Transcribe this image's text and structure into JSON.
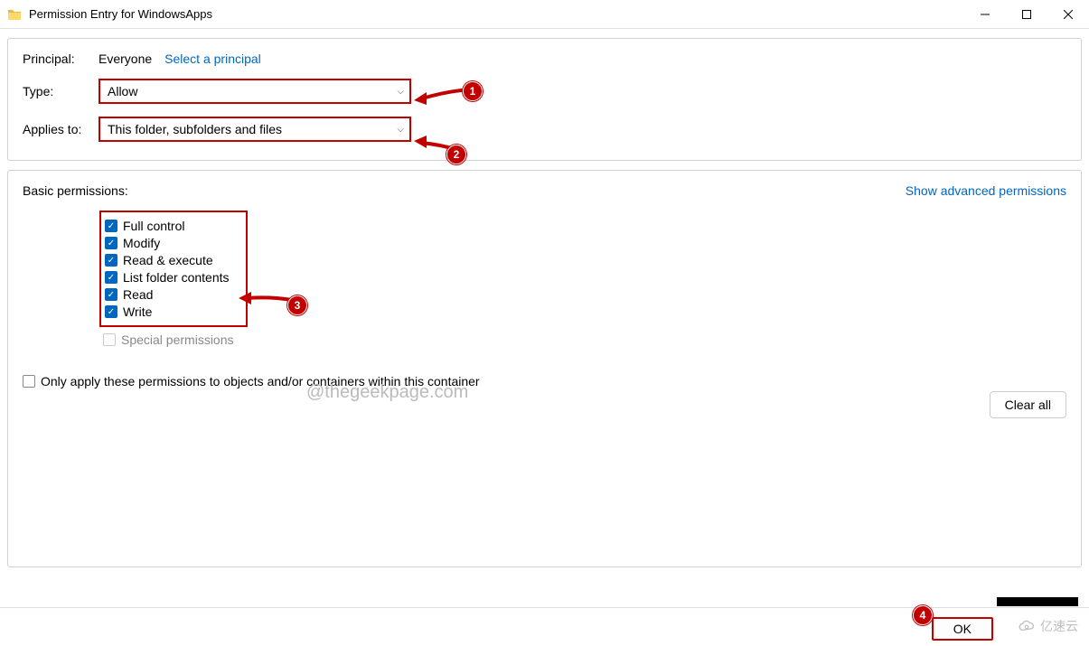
{
  "titlebar": {
    "title": "Permission Entry for WindowsApps"
  },
  "top": {
    "principal_label": "Principal:",
    "principal_value": "Everyone",
    "select_principal": "Select a principal",
    "type_label": "Type:",
    "type_value": "Allow",
    "applies_label": "Applies to:",
    "applies_value": "This folder, subfolders and files"
  },
  "perms": {
    "header": "Basic permissions:",
    "advanced_link": "Show advanced permissions",
    "items": {
      "full_control": "Full control",
      "modify": "Modify",
      "read_execute": "Read & execute",
      "list_folder": "List folder contents",
      "read": "Read",
      "write": "Write",
      "special": "Special permissions"
    },
    "only_apply": "Only apply these permissions to objects and/or containers within this container",
    "clear_all": "Clear all"
  },
  "footer": {
    "ok": "OK"
  },
  "watermark": "@thegeekpage.com",
  "yisu": "亿速云",
  "callouts": {
    "c1": "1",
    "c2": "2",
    "c3": "3",
    "c4": "4"
  }
}
